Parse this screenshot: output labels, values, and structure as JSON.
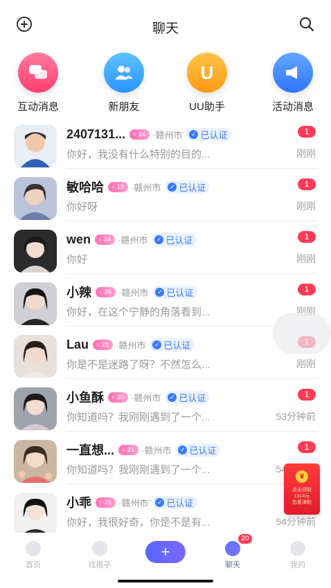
{
  "header": {
    "title": "聊天"
  },
  "quick_actions": [
    {
      "label": "互动消息",
      "color": "#ff4f7b",
      "icon": "chat-bubbles-icon"
    },
    {
      "label": "新朋友",
      "color": "#36a7ff",
      "icon": "people-icon"
    },
    {
      "label": "UU助手",
      "color": "#ffaa1f",
      "icon": "uu-icon"
    },
    {
      "label": "活动消息",
      "color": "#3e8bff",
      "icon": "megaphone-icon"
    }
  ],
  "chats": [
    {
      "name": "2407131...",
      "age": "24",
      "city": "·赣州市",
      "verified": "已认证",
      "preview": "你好，我没有什么特别的目的...",
      "unread": "1",
      "time": "刚刚"
    },
    {
      "name": "敏哈哈",
      "age": "19",
      "city": "·赣州市",
      "verified": "已认证",
      "preview": "你好呀",
      "unread": "1",
      "time": "刚刚"
    },
    {
      "name": "wen",
      "age": "24",
      "city": "·赣州市",
      "verified": "已认证",
      "preview": "你好",
      "unread": "1",
      "time": "刚刚"
    },
    {
      "name": "小辣",
      "age": "25",
      "city": "·赣州市",
      "verified": "已认证",
      "preview": "你好，在这个宁静的角落看到...",
      "unread": "1",
      "time": "刚刚"
    },
    {
      "name": "Lau",
      "age": "21",
      "city": "·赣州市",
      "verified": "已认证",
      "preview": "你是不是迷路了呀？不然怎么...",
      "unread": "1",
      "time": "刚刚"
    },
    {
      "name": "小鱼酥",
      "age": "20",
      "city": "·赣州市",
      "verified": "已认证",
      "preview": "你知道吗？我刚刚遇到了一个...",
      "unread": "1",
      "time": "53分钟前"
    },
    {
      "name": "一直想...",
      "age": "21",
      "city": "·赣州市",
      "verified": "已认证",
      "preview": "你知道吗？我刚刚遇到了一个...",
      "unread": "1",
      "time": "54分钟前"
    },
    {
      "name": "小乖",
      "age": "21",
      "city": "·赣州市",
      "verified": "已认证",
      "preview": "你好，我很好奇，你是不是有...",
      "unread": "",
      "time": "54分钟前"
    }
  ],
  "red_envelope": {
    "line1": "点击领取",
    "line2": "1314元",
    "line3": "恋爱津贴"
  },
  "tabbar": {
    "tabs": [
      {
        "label": "首页"
      },
      {
        "label": "找搭子"
      },
      {
        "label": "聊天",
        "badge": "20"
      },
      {
        "label": "我的"
      }
    ],
    "plus": "+"
  }
}
